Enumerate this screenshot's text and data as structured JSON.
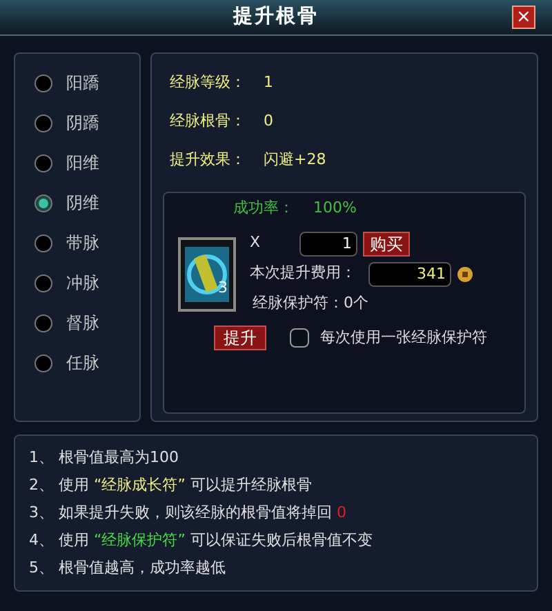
{
  "window": {
    "title": "提升根骨",
    "close": "×"
  },
  "meridians": [
    {
      "label": "阳蹻",
      "selected": false
    },
    {
      "label": "阴蹻",
      "selected": false
    },
    {
      "label": "阳维",
      "selected": false
    },
    {
      "label": "阴维",
      "selected": true
    },
    {
      "label": "带脉",
      "selected": false
    },
    {
      "label": "冲脉",
      "selected": false
    },
    {
      "label": "督脉",
      "selected": false
    },
    {
      "label": "任脉",
      "selected": false
    }
  ],
  "stats": [
    {
      "label": "经脉等级：",
      "value": "1"
    },
    {
      "label": "经脉根骨：",
      "value": "0"
    },
    {
      "label": "提升效果：",
      "value": "闪避+28"
    }
  ],
  "upgrade": {
    "success_label": "成功率：",
    "success_value": "100%",
    "item_count": "3",
    "multiply": "X",
    "quantity": "1",
    "buy_button": "购买",
    "cost_label": "本次提升费用：",
    "cost": "341",
    "protect_label": "经脉保护符：0个",
    "upgrade_button": "提升",
    "auto_protect": {
      "label": "每次使用一张经脉保护符",
      "checked": false
    }
  },
  "notes": [
    [
      {
        "kind": "plain",
        "text": "1、 根骨值最高为100"
      }
    ],
    [
      {
        "kind": "plain",
        "text": "2、 使用 "
      },
      {
        "kind": "yellow",
        "text": "“经脉成长符”"
      },
      {
        "kind": "plain",
        "text": " 可以提升经脉根骨"
      }
    ],
    [
      {
        "kind": "plain",
        "text": "3、 如果提升失败，则该经脉的根骨值将掉回 "
      },
      {
        "kind": "red",
        "text": "0"
      }
    ],
    [
      {
        "kind": "plain",
        "text": "4、 使用 "
      },
      {
        "kind": "green",
        "text": "“经脉保护符”"
      },
      {
        "kind": "plain",
        "text": " 可以保证失败后根骨值不变"
      }
    ],
    [
      {
        "kind": "plain",
        "text": "5、 根骨值越高，成功率越低"
      }
    ]
  ]
}
